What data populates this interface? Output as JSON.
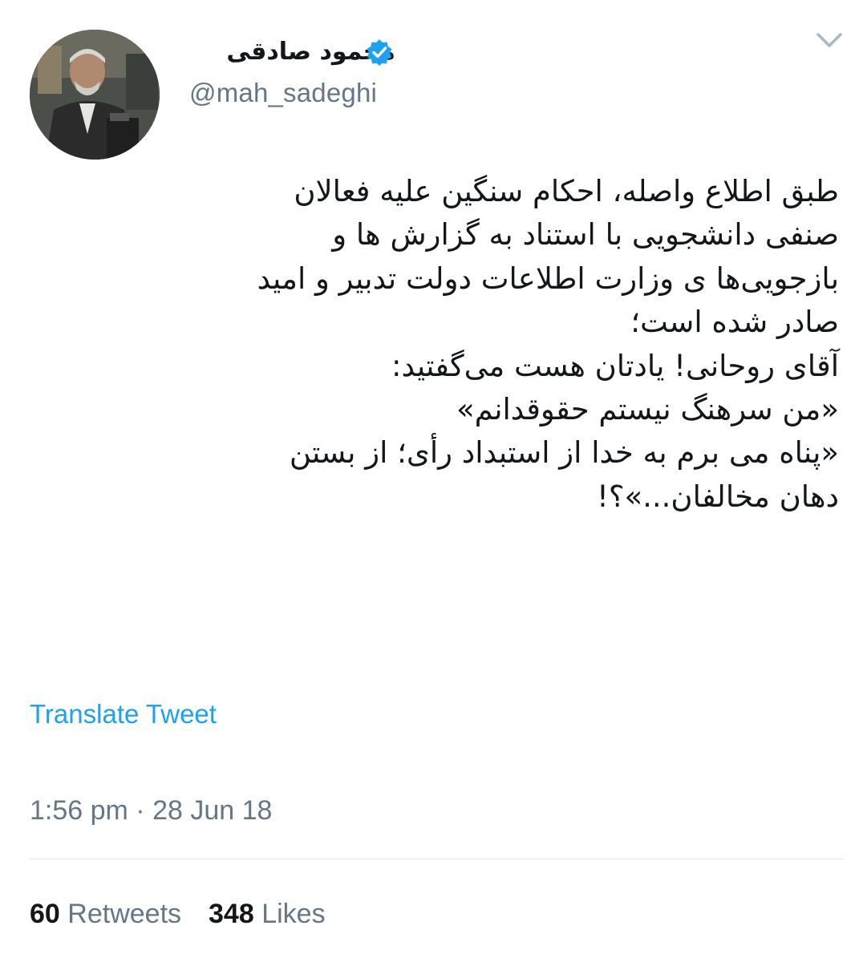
{
  "author": {
    "display_name": "محمود صادقی",
    "handle": "@mah_sadeghi",
    "verified_icon": "verified-badge-icon",
    "avatar_icon": "profile-photo"
  },
  "menu_icon": "chevron-down-icon",
  "tweet": {
    "lines": [
      "طبق اطلاع واصله، احکام سنگین علیه فعالان",
      "صنفی دانشجویی با استناد به گزارش ها و",
      "بازجویی‌ها ی وزارت اطلاعات دولت تدبیر و امید",
      "صادر شده است؛",
      "آقای روحانی! یادتان هست می‌گفتید:",
      "«من سرهنگ نیستم حقوقدانم»",
      "«پناه می برم به خدا از استبداد رأی؛ از بستن",
      "دهان مخالفان...»؟!"
    ]
  },
  "translate_label": "Translate Tweet",
  "timestamp": "1:56 pm · 28 Jun 18",
  "stats": {
    "retweets_count": "60",
    "retweets_label": "Retweets",
    "likes_count": "348",
    "likes_label": "Likes"
  },
  "colors": {
    "accent": "#1da1f2",
    "secondary_text": "#657786",
    "primary_text": "#14171a",
    "divider": "#e1e8ed"
  }
}
